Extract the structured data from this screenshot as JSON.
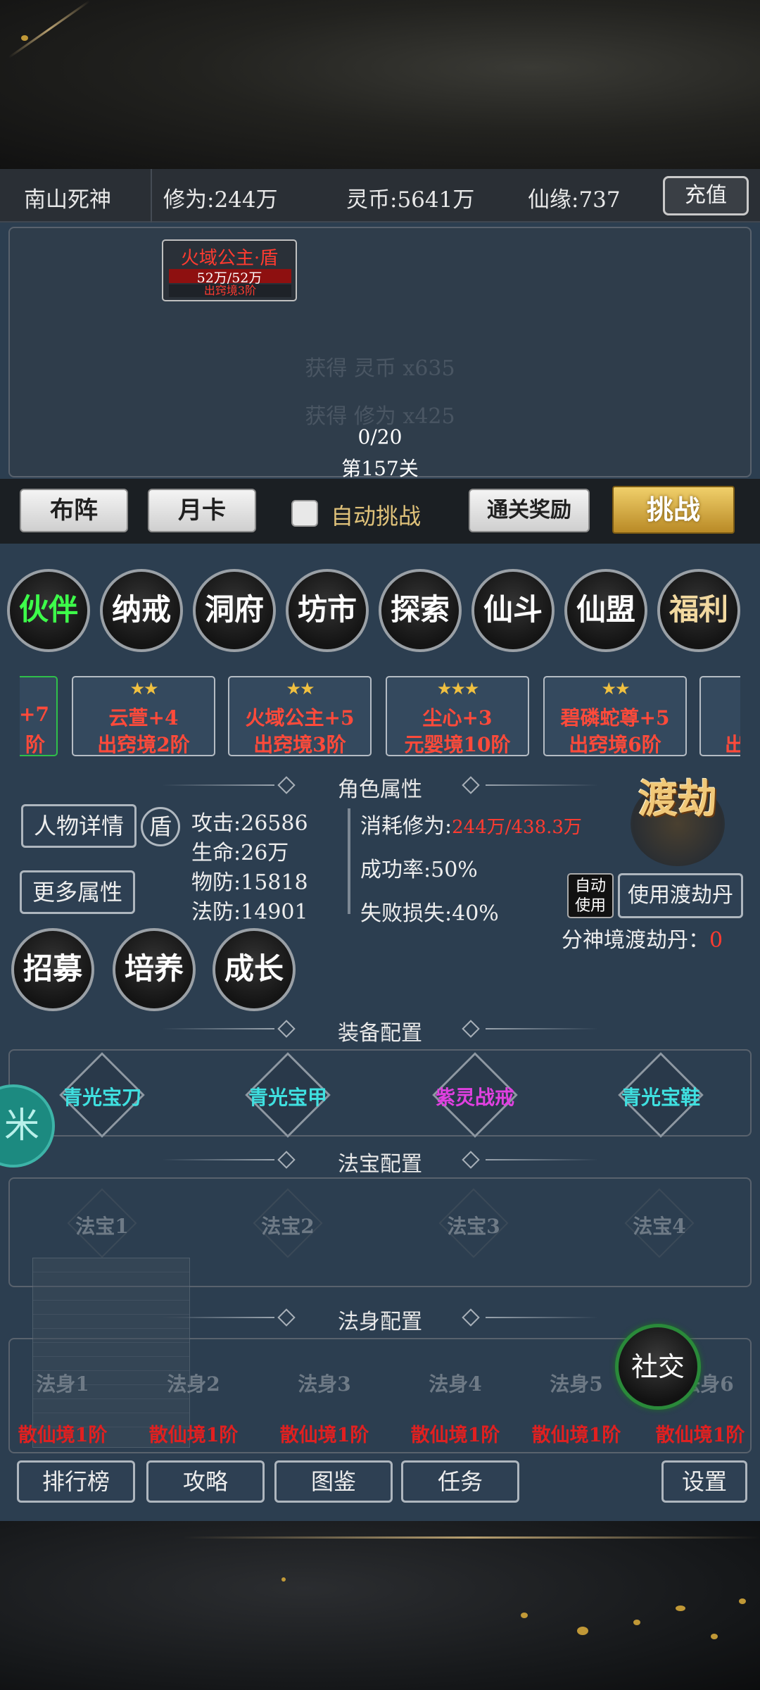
{
  "topbar": {
    "player_name": "南山死神",
    "cultivation": "修为:244万",
    "spirit_coins": "灵币:5641万",
    "xianyuan": "仙缘:737",
    "recharge_label": "充值"
  },
  "battle": {
    "enemy_name": "火域公主·盾",
    "enemy_hp": "52万/52万",
    "enemy_hp_fraction": 1.0,
    "enemy_realm": "出窍境3阶",
    "reward_1": "获得 灵币 x635",
    "reward_2": "获得 修为 x425",
    "kill_progress": "0/20",
    "stage": "第157关"
  },
  "actions": {
    "formation": "布阵",
    "monthly_card": "月卡",
    "auto_challenge": "自动挑战",
    "auto_challenge_checked": false,
    "clear_reward": "通关奖励",
    "challenge": "挑战"
  },
  "menu": [
    "伙伴",
    "纳戒",
    "洞府",
    "坊市",
    "探索",
    "仙斗",
    "仙盟",
    "福利"
  ],
  "partners": [
    {
      "stars": "",
      "name": "+7",
      "realm": "阶"
    },
    {
      "stars": "★★",
      "name": "云萱+4",
      "realm": "出窍境2阶"
    },
    {
      "stars": "★★",
      "name": "火域公主+5",
      "realm": "出窍境3阶"
    },
    {
      "stars": "★★★",
      "name": "尘心+3",
      "realm": "元婴境10阶"
    },
    {
      "stars": "★★",
      "name": "碧磷蛇尊+5",
      "realm": "出窍境6阶"
    },
    {
      "stars": "",
      "name": "",
      "realm": "出"
    }
  ],
  "attributes": {
    "section_title": "角色属性",
    "detail_btn": "人物详情",
    "shield": "盾",
    "more_btn": "更多属性",
    "attack": "攻击:26586",
    "hp": "生命:26万",
    "phys_def": "物防:15818",
    "magic_def": "法防:14901",
    "consume_label": "消耗修为:",
    "consume_value": "244万/438.3万",
    "success_rate": "成功率:50%",
    "fail_loss": "失败损失:40%",
    "tribulation": "渡劫",
    "auto_use": "自动使用",
    "use_pill": "使用渡劫丹",
    "pill_label": "分神境渡劫丹：",
    "pill_count": "0"
  },
  "growth": [
    "招募",
    "培养",
    "成长"
  ],
  "equipment": {
    "section_title": "装备配置",
    "items": [
      {
        "name": "青光宝刀",
        "color": "#3fe0e0"
      },
      {
        "name": "青光宝甲",
        "color": "#3fe0e0"
      },
      {
        "name": "紫灵战戒",
        "color": "#e040e0"
      },
      {
        "name": "青光宝鞋",
        "color": "#3fe0e0"
      }
    ]
  },
  "treasure": {
    "section_title": "法宝配置",
    "slots": [
      "法宝1",
      "法宝2",
      "法宝3",
      "法宝4"
    ]
  },
  "dharma_body": {
    "section_title": "法身配置",
    "slots": [
      {
        "name": "法身1",
        "realm": "散仙境1阶"
      },
      {
        "name": "法身2",
        "realm": "散仙境1阶"
      },
      {
        "name": "法身3",
        "realm": "散仙境1阶"
      },
      {
        "name": "法身4",
        "realm": "散仙境1阶"
      },
      {
        "name": "法身5",
        "realm": "散仙境1阶"
      },
      {
        "name": "法身6",
        "realm": "散仙境1阶"
      }
    ]
  },
  "social": "社交",
  "side_orb": "米",
  "bottom": {
    "ranking": "排行榜",
    "guide": "攻略",
    "codex": "图鉴",
    "tasks": "任务",
    "settings": "设置"
  },
  "colors": {
    "panel_bg": "#2c3e50",
    "enemy_red": "#ff3b30",
    "gold_button": "#d8ab40",
    "menu_active_green": "#3dff4a",
    "menu_gold": "#f2d9a0"
  }
}
